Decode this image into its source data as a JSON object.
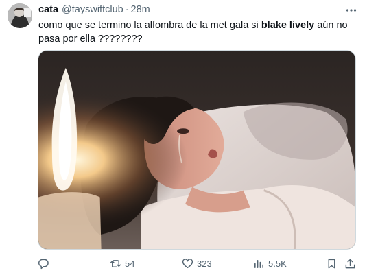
{
  "tweet": {
    "author": {
      "display_name": "cata",
      "handle": "@tayswiftclub",
      "separator": "·",
      "time": "28m"
    },
    "text_parts": {
      "before": "como que se termino la alfombra de la met gala si ",
      "bold": "blake lively",
      "after": " aún no pasa por ella ????????"
    },
    "media": {
      "description_icon": "photo-image"
    },
    "actions": {
      "reply": {
        "icon": "reply-icon",
        "count": ""
      },
      "retweet": {
        "icon": "retweet-icon",
        "count": "54"
      },
      "like": {
        "icon": "heart-icon",
        "count": "323"
      },
      "views": {
        "icon": "views-icon",
        "count": "5.5K"
      },
      "bookmark": {
        "icon": "bookmark-icon"
      },
      "share": {
        "icon": "share-icon"
      }
    },
    "more_icon": "more-dots-icon",
    "colors": {
      "text": "#0f1419",
      "secondary": "#536471",
      "border": "#cfd9de"
    }
  }
}
